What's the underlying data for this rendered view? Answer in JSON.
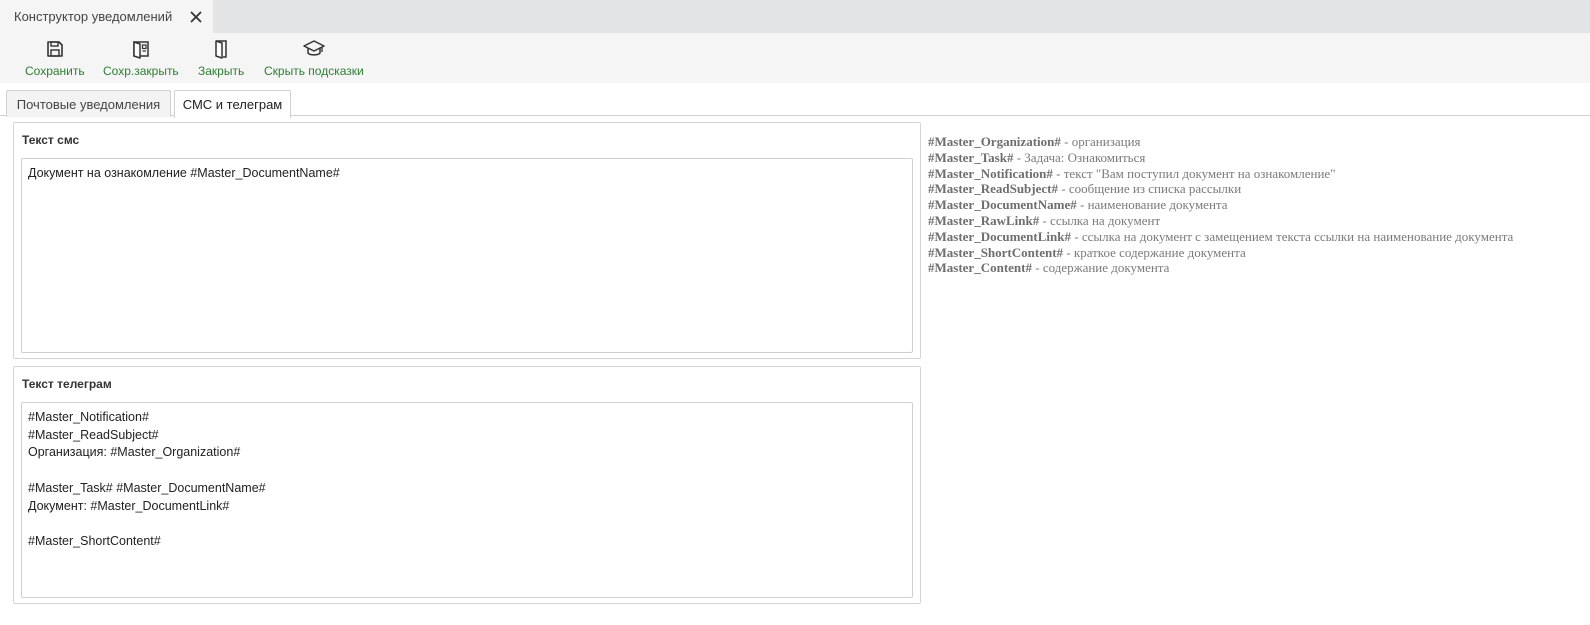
{
  "window": {
    "tab_title": "Конструктор уведомлений",
    "close_icon": "close-icon"
  },
  "toolbar": {
    "save": {
      "label": "Сохранить",
      "icon": "floppy-disk-icon"
    },
    "save_close": {
      "label": "Сохр.закрыть",
      "icon": "save-close-door-icon"
    },
    "close": {
      "label": "Закрыть",
      "icon": "door-icon"
    },
    "hide_hints": {
      "label": "Скрыть подсказки",
      "icon": "graduation-cap-icon"
    },
    "label_color": "#2e7d32"
  },
  "tabs": [
    {
      "label": "Почтовые уведомления",
      "active": false
    },
    {
      "label": "СМС и телеграм",
      "active": true
    }
  ],
  "sms": {
    "title": "Текст смс",
    "text": "Документ на ознакомление #Master_DocumentName#"
  },
  "telegram": {
    "title": "Текст телеграм",
    "text": "#Master_Notification#\n#Master_ReadSubject#\nОрганизация: #Master_Organization#\n\n#Master_Task# #Master_DocumentName#\nДокумент: #Master_DocumentLink#\n\n#Master_ShortContent#"
  },
  "hints": [
    {
      "key": "#Master_Organization#",
      "desc": " - организация"
    },
    {
      "key": "#Master_Task#",
      "desc": " - Задача: Ознакомиться"
    },
    {
      "key": "#Master_Notification#",
      "desc": " - текст \"Вам поступил документ на ознакомление\""
    },
    {
      "key": "#Master_ReadSubject#",
      "desc": " - сообщение из списка рассылки"
    },
    {
      "key": "#Master_DocumentName#",
      "desc": " - наименование документа"
    },
    {
      "key": "#Master_RawLink#",
      "desc": " - ссылка на документ"
    },
    {
      "key": "#Master_DocumentLink#",
      "desc": " - ссылка на документ с замещением текста ссылки на наименование документа"
    },
    {
      "key": "#Master_ShortContent#",
      "desc": " - краткое содержание документа"
    },
    {
      "key": "#Master_Content#",
      "desc": " - содержание документа"
    }
  ]
}
